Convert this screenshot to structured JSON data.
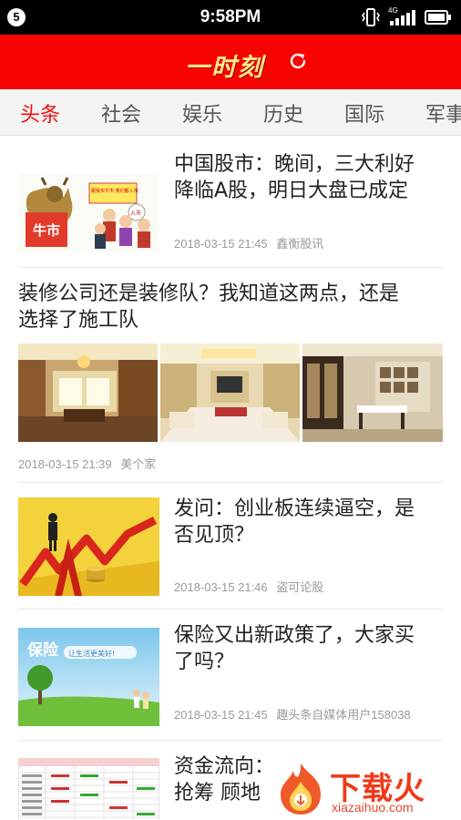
{
  "status_bar": {
    "badge": "5",
    "time": "9:58PM",
    "network": "4G"
  },
  "header": {
    "title": "一时刻",
    "refresh_icon": "refresh-icon"
  },
  "tabs": [
    {
      "label": "头条",
      "active": true
    },
    {
      "label": "社会",
      "active": false
    },
    {
      "label": "娱乐",
      "active": false
    },
    {
      "label": "历史",
      "active": false
    },
    {
      "label": "国际",
      "active": false
    },
    {
      "label": "军事",
      "active": false
    }
  ],
  "articles": [
    {
      "title_lines": [
        "中国股市：晚间，三大利好",
        "降临A股，明日大盘已成定"
      ],
      "time": "2018-03-15 21:45",
      "source": "鑫衡股讯",
      "thumb_text": "牛市",
      "thumb_sign": "跟我买牛市 我们都入市",
      "thumb_bubble": "入市"
    },
    {
      "title_lines": [
        "装修公司还是装修队？我知道这两点，还是",
        "选择了施工队"
      ],
      "time": "2018-03-15 21:39",
      "source": "美个家"
    },
    {
      "title_lines": [
        "发问：创业板连续逼空，是",
        "否见顶？"
      ],
      "time": "2018-03-15 21:46",
      "source": "盗可论股"
    },
    {
      "title_lines": [
        "保险又出新政策了，大家买",
        "了吗？"
      ],
      "time": "2018-03-15 21:45",
      "source": "趣头条自媒体用户158038",
      "thumb_text": "保险",
      "thumb_sub": "让生活更美好!"
    },
    {
      "title_lines": [
        "资金流向：",
        "抢筹 顾地"
      ],
      "time": "",
      "source": ""
    }
  ],
  "watermark": {
    "text": "下载火",
    "url": "xiazaihuo.com"
  },
  "colors": {
    "brand_red": "#f80400",
    "title_gold": "#ffe98a",
    "active_tab": "#f01010",
    "meta_gray": "#9a9a9a"
  }
}
